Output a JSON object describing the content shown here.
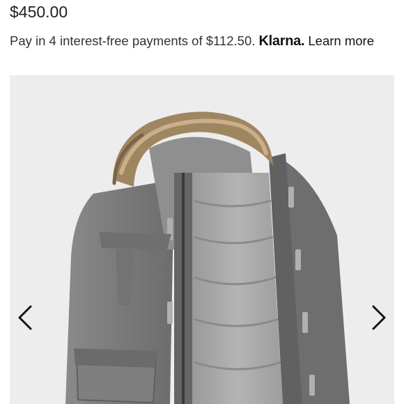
{
  "product": {
    "price": "$450.00"
  },
  "klarna": {
    "text": "Pay in 4 interest-free payments of $112.50.",
    "brand": "Klarna.",
    "link": "Learn more"
  },
  "gallery": {
    "image_description": "Gray parka with fur-trimmed hood",
    "prev_icon": "chevron-left-icon",
    "next_icon": "chevron-right-icon"
  },
  "colors": {
    "background": "#ffffff",
    "gallery_bg": "#ededed",
    "jacket_shell": "#7d7d7d",
    "jacket_lining": "#a9a9a9",
    "fur": "#a08660"
  }
}
